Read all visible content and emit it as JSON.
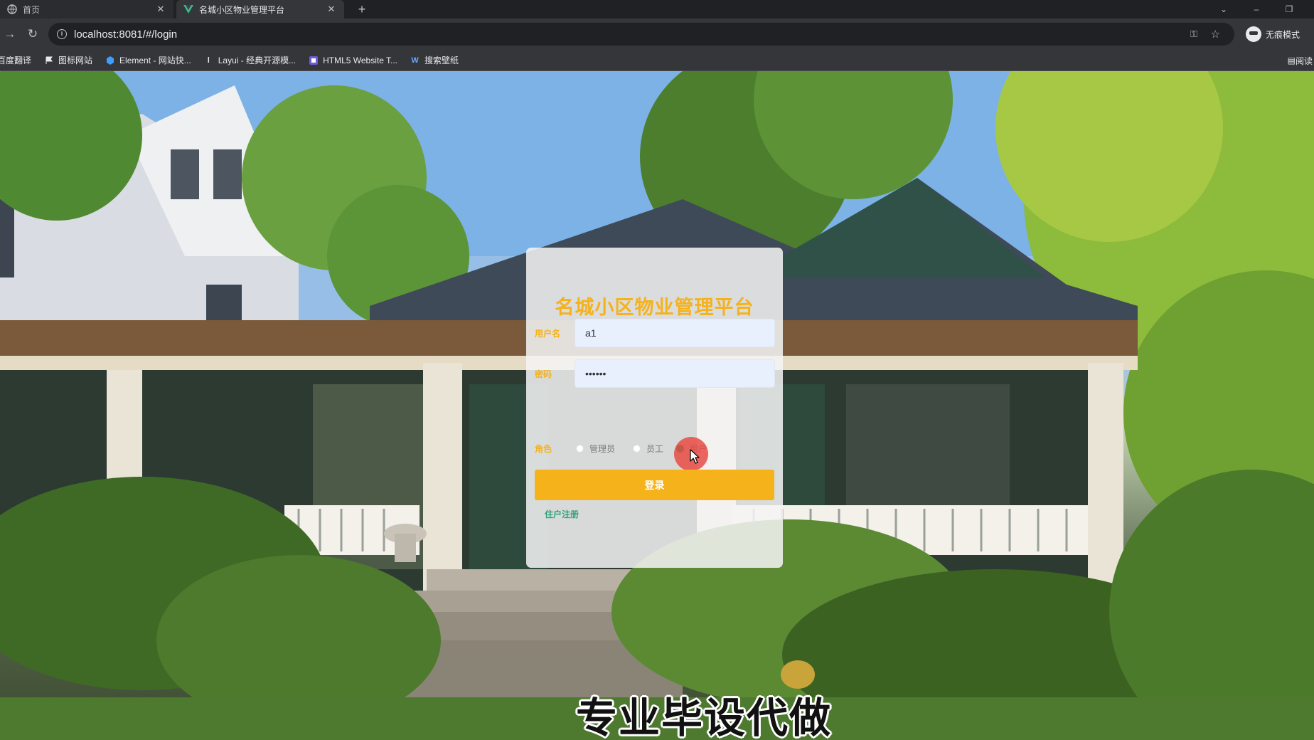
{
  "browser": {
    "tabs": [
      {
        "title": "首页",
        "active": false
      },
      {
        "title": "名城小区物业管理平台",
        "active": true
      }
    ],
    "url": "localhost:8081/#/login",
    "profile_label": "无痕模式",
    "bookmarks": [
      {
        "label": "百度翻译",
        "icon": "translate-icon"
      },
      {
        "label": "图标网站",
        "icon": "flag-icon"
      },
      {
        "label": "Element - 网站快...",
        "icon": "element-icon"
      },
      {
        "label": "Layui - 经典开源模...",
        "icon": "layui-icon"
      },
      {
        "label": "HTML5 Website T...",
        "icon": "html5-icon"
      },
      {
        "label": "搜索壁纸",
        "icon": "wallpaper-icon"
      }
    ],
    "reading_list_label": "阅读"
  },
  "login": {
    "title": "名城小区物业管理平台",
    "username_label": "用户名",
    "username_value": "a1",
    "password_label": "密码",
    "password_value": "••••••",
    "role_label": "角色",
    "roles": [
      {
        "label": "管理员",
        "checked": false
      },
      {
        "label": "员工",
        "checked": false
      },
      {
        "label": "用户",
        "checked": true
      }
    ],
    "submit_label": "登录",
    "register_link": "住户注册"
  },
  "colors": {
    "accent": "#f5b21a",
    "link": "#2fa27a",
    "cursor_highlight": "#e8463e"
  },
  "overlay": {
    "watermark": "专业毕设代做"
  }
}
